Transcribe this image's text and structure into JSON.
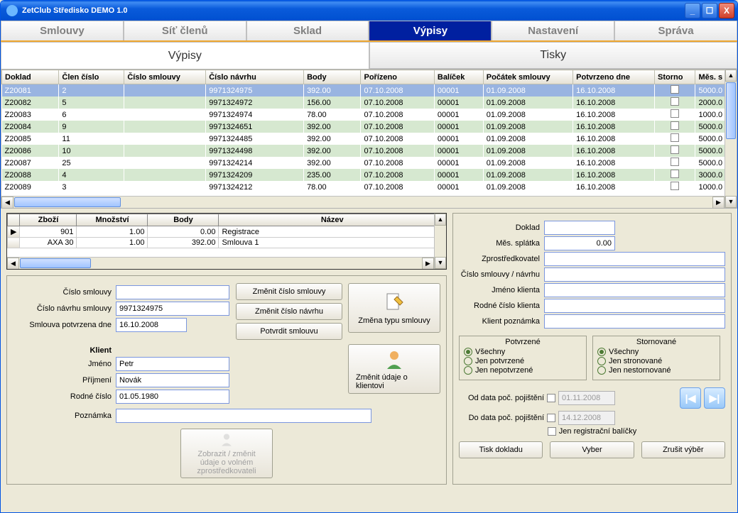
{
  "window_title": "ZetClub Středisko DEMO 1.0",
  "tabs": [
    "Smlouvy",
    "Síť členů",
    "Sklad",
    "Výpisy",
    "Nastavení",
    "Správa"
  ],
  "active_tab": 3,
  "subtabs": [
    "Výpisy",
    "Tisky"
  ],
  "active_subtab": 0,
  "grid_headers": [
    "Doklad",
    "Člen číslo",
    "Číslo smlouvy",
    "Číslo návrhu",
    "Body",
    "Pořízeno",
    "Balíček",
    "Počátek smlouvy",
    "Potvrzeno dne",
    "Storno",
    "Měs. s"
  ],
  "grid_rows": [
    {
      "sel": true,
      "cells": [
        "Z20081",
        "2",
        "",
        "9971324975",
        "392.00",
        "07.10.2008",
        "00001",
        "01.09.2008",
        "16.10.2008",
        "",
        "5000.0"
      ]
    },
    {
      "sel": false,
      "cells": [
        "Z20082",
        "5",
        "",
        "9971324972",
        "156.00",
        "07.10.2008",
        "00001",
        "01.09.2008",
        "16.10.2008",
        "",
        "2000.0"
      ]
    },
    {
      "sel": false,
      "cells": [
        "Z20083",
        "6",
        "",
        "9971324974",
        "78.00",
        "07.10.2008",
        "00001",
        "01.09.2008",
        "16.10.2008",
        "",
        "1000.0"
      ]
    },
    {
      "sel": false,
      "cells": [
        "Z20084",
        "9",
        "",
        "9971324651",
        "392.00",
        "07.10.2008",
        "00001",
        "01.09.2008",
        "16.10.2008",
        "",
        "5000.0"
      ]
    },
    {
      "sel": false,
      "cells": [
        "Z20085",
        "11",
        "",
        "9971324485",
        "392.00",
        "07.10.2008",
        "00001",
        "01.09.2008",
        "16.10.2008",
        "",
        "5000.0"
      ]
    },
    {
      "sel": false,
      "cells": [
        "Z20086",
        "10",
        "",
        "9971324498",
        "392.00",
        "07.10.2008",
        "00001",
        "01.09.2008",
        "16.10.2008",
        "",
        "5000.0"
      ]
    },
    {
      "sel": false,
      "cells": [
        "Z20087",
        "25",
        "",
        "9971324214",
        "392.00",
        "07.10.2008",
        "00001",
        "01.09.2008",
        "16.10.2008",
        "",
        "5000.0"
      ]
    },
    {
      "sel": false,
      "cells": [
        "Z20088",
        "4",
        "",
        "9971324209",
        "235.00",
        "07.10.2008",
        "00001",
        "01.09.2008",
        "16.10.2008",
        "",
        "3000.0"
      ]
    },
    {
      "sel": false,
      "cells": [
        "Z20089",
        "3",
        "",
        "9971324212",
        "78.00",
        "07.10.2008",
        "00001",
        "01.09.2008",
        "16.10.2008",
        "",
        "1000.0"
      ]
    }
  ],
  "detail_headers": [
    "Zboží",
    "Množství",
    "Body",
    "Název"
  ],
  "detail_rows": [
    [
      "901",
      "1.00",
      "0.00",
      "Registrace"
    ],
    [
      "AXA 30",
      "1.00",
      "392.00",
      "Smlouva 1"
    ]
  ],
  "form": {
    "cislo_smlouvy_label": "Číslo smlouvy",
    "cislo_smlouvy": "",
    "cislo_navrhu_label": "Číslo návrhu smlouvy",
    "cislo_navrhu": "9971324975",
    "potvrzena_label": "Smlouva potvrzena dne",
    "potvrzena": "16.10.2008",
    "klient_title": "Klient",
    "jmeno_label": "Jméno",
    "jmeno": "Petr",
    "prijmeni_label": "Příjmení",
    "prijmeni": "Novák",
    "rodne_label": "Rodné číslo",
    "rodne": "01.05.1980",
    "poznamka_label": "Poznámka",
    "poznamka": ""
  },
  "buttons": {
    "zmenit_cislo_smlouvy": "Změnit číslo smlouvy",
    "zmenit_cislo_navrhu": "Změnit číslo návrhu",
    "potvrdit_smlouvu": "Potvrdit smlouvu",
    "zmena_typu": "Změna typu smlouvy",
    "zmenit_klienta": "Změnit údaje o klientovi",
    "zobrazit_zprost": "Zobrazit / změnit údaje o volném zprostředkovateli"
  },
  "filter": {
    "doklad_label": "Doklad",
    "doklad": "",
    "splatka_label": "Měs. splátka",
    "splatka": "0.00",
    "zprost_label": "Zprostředkovatel",
    "zprost": "",
    "cislo_label": "Číslo smlouvy / návrhu",
    "cislo": "",
    "jmeno_label": "Jméno klienta",
    "jmeno": "",
    "rodne_label": "Rodné číslo klienta",
    "rodne": "",
    "poznamka_label": "Klient poznámka",
    "poznamka": "",
    "potvrzene_title": "Potvrzené",
    "potvrzene_opts": [
      "Všechny",
      "Jen potvrzené",
      "Jen nepotvrzené"
    ],
    "potvrzene_sel": 0,
    "storno_title": "Stornované",
    "storno_opts": [
      "Všechny",
      "Jen stronované",
      "Jen nestornované"
    ],
    "storno_sel": 0,
    "od_label": "Od data poč. pojištění",
    "od": "01.11.2008",
    "do_label": "Do data poč. pojištění",
    "do": "14.12.2008",
    "jen_reg": "Jen registrační balíčky",
    "tisk": "Tisk dokladu",
    "vyber": "Vyber",
    "zrusit": "Zrušit výběr"
  }
}
